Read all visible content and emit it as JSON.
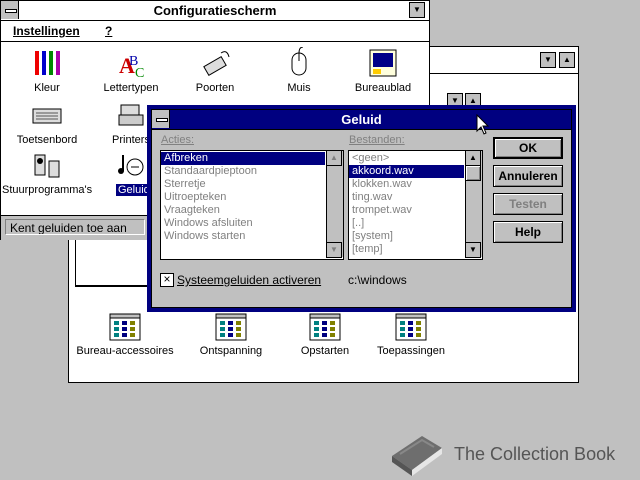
{
  "control_panel": {
    "title": "Configuratiescherm",
    "menu": [
      "Instellingen",
      "?"
    ],
    "icons": [
      "Kleur",
      "Lettertypen",
      "Poorten",
      "Muis",
      "Bureaublad",
      "Toetsenbord",
      "Printers",
      "Stuurprogramma's",
      "Geluid"
    ],
    "status": "Kent geluiden toe aan"
  },
  "program_manager": {
    "groups": [
      "Bureau-accessoires",
      "Ontspanning",
      "Opstarten",
      "Toepassingen"
    ]
  },
  "dialog": {
    "title": "Geluid",
    "events_label": "Acties:",
    "files_label": "Bestanden:",
    "events": [
      "Afbreken",
      "Standaardpieptoon",
      "Sterretje",
      "Uitroepteken",
      "Vraagteken",
      "Windows afsluiten",
      "Windows starten"
    ],
    "files": [
      "<geen>",
      "akkoord.wav",
      "klokken.wav",
      "ting.wav",
      "trompet.wav",
      "[..]",
      "[system]",
      "[temp]"
    ],
    "checkbox_label": "Systeemgeluiden activeren",
    "path": "c:\\windows",
    "buttons": [
      "OK",
      "Annuleren",
      "Testen",
      "Help"
    ]
  },
  "watermark": "The Collection Book",
  "colors": {
    "desktop": "#c0c0c0",
    "active_title": "#000080",
    "selection": "#000080"
  }
}
